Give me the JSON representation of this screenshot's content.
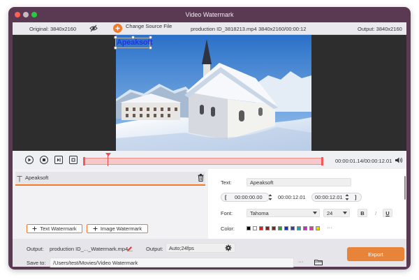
{
  "window": {
    "title": "Video Watermark"
  },
  "info_bar": {
    "original": "Original: 3840x2160",
    "change_source": "Change Source File",
    "file_name": "production ID_3818213.mp4",
    "file_meta": "3840x2160/00:00:12",
    "output": "Output: 3840x2160"
  },
  "preview": {
    "watermark_text": "Apeaksoft"
  },
  "timeline": {
    "timecode": "00:00:01.14/00:00:12.01",
    "playhead_fraction": 0.1
  },
  "watermark_list": {
    "items": [
      {
        "label": "Apeaksoft"
      }
    ],
    "add_text_label": "Text Watermark",
    "add_image_label": "Image Watermark"
  },
  "settings": {
    "text_label": "Text:",
    "text_value": "Apeaksoft",
    "range_start_bracket": "[",
    "start_time": "00:00:00.00",
    "mid_time": "00:00:12.01",
    "end_time": "00:00:12.01",
    "range_end_bracket": "]",
    "font_label": "Font:",
    "font_value": "Tahoma",
    "font_size": "24",
    "bold": "B",
    "italic": "I",
    "underline": "U",
    "color_label": "Color:",
    "more_colors": "···",
    "colors": [
      "#000000",
      "#ffffff",
      "#e02020",
      "#8b1a1a",
      "#6b2e1a",
      "#2c9b3a",
      "#1530b8",
      "#3a3a9b",
      "#2aa198",
      "#c030c0",
      "#e03a9b",
      "#f0d000"
    ]
  },
  "footer": {
    "output_label": "Output:",
    "output_file": "production ID_..._Watermark.mp4",
    "output_format_label": "Output:",
    "output_format": "Auto;24fps",
    "save_label": "Save to:",
    "save_path": "/Users/test/Movies/Video Watermark",
    "browse": "···",
    "export": "Export"
  }
}
